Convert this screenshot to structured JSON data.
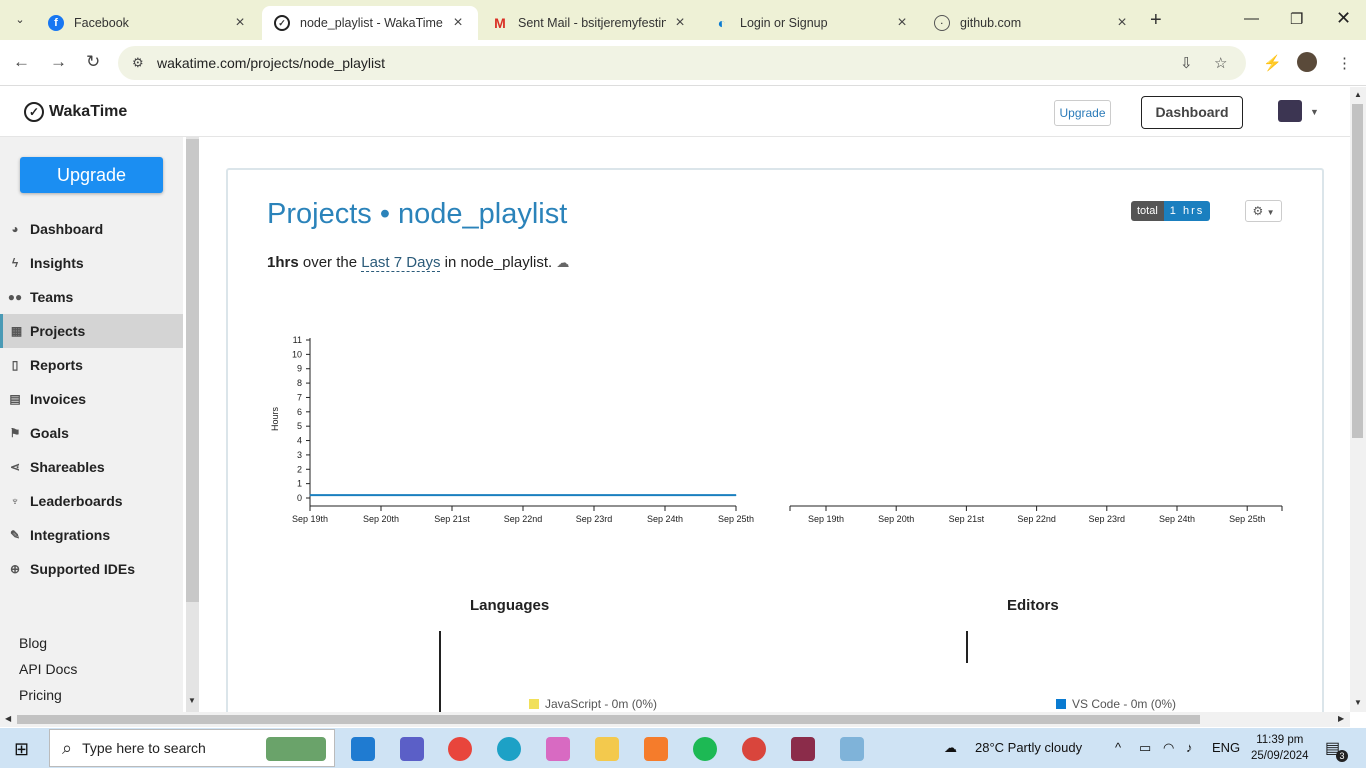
{
  "browser": {
    "tabs": [
      {
        "title": "Facebook",
        "icon": "facebook-icon"
      },
      {
        "title": "node_playlist - WakaTime",
        "icon": "wakatime-icon"
      },
      {
        "title": "Sent Mail - bsitjeremyfestin@",
        "icon": "gmail-icon"
      },
      {
        "title": "Login or Signup",
        "icon": "login-icon"
      },
      {
        "title": "github.com",
        "icon": "globe-icon"
      }
    ],
    "url": "wakatime.com/projects/node_playlist"
  },
  "header": {
    "logo": "WakaTime",
    "upgrade_label": "Upgrade",
    "dashboard_label": "Dashboard"
  },
  "sidebar": {
    "upgrade_label": "Upgrade",
    "items": [
      {
        "label": "Dashboard",
        "icon": "dashboard-icon"
      },
      {
        "label": "Insights",
        "icon": "bolt-icon"
      },
      {
        "label": "Teams",
        "icon": "users-icon"
      },
      {
        "label": "Projects",
        "icon": "grid-icon"
      },
      {
        "label": "Reports",
        "icon": "report-icon"
      },
      {
        "label": "Invoices",
        "icon": "invoice-icon"
      },
      {
        "label": "Goals",
        "icon": "flag-icon"
      },
      {
        "label": "Shareables",
        "icon": "share-icon"
      },
      {
        "label": "Leaderboards",
        "icon": "trophy-icon"
      },
      {
        "label": "Integrations",
        "icon": "wrench-icon"
      },
      {
        "label": "Supported IDEs",
        "icon": "plus-circle-icon"
      }
    ],
    "links": [
      "Blog",
      "API Docs",
      "Pricing"
    ]
  },
  "main": {
    "title": "Projects • node_playlist",
    "summary": {
      "hours": "1hrs",
      "text1": " over the ",
      "range": "Last 7 Days",
      "text2": " in node_playlist."
    },
    "badge_left": "total",
    "badge_right": "1 hrs",
    "languages_title": "Languages",
    "editors_title": "Editors",
    "languages_legend": "JavaScript - 0m (0%)",
    "editors_legend": "VS Code - 0m (0%)",
    "javascript_color": "#f1e05a",
    "vscode_color": "#0a7bd1"
  },
  "chart_data": [
    {
      "type": "line",
      "x": [
        "Sep 19th",
        "Sep 20th",
        "Sep 21st",
        "Sep 22nd",
        "Sep 23rd",
        "Sep 24th",
        "Sep 25th"
      ],
      "values": [
        0.2,
        0.2,
        0.2,
        0.2,
        0.2,
        0.2,
        0.2
      ],
      "ylabel": "Hours",
      "yticks": [
        "0",
        "1",
        "2",
        "3",
        "4",
        "5",
        "6",
        "7",
        "8",
        "9",
        "10",
        "11"
      ],
      "ylim": [
        0,
        11
      ],
      "color": "#1a7fbf"
    },
    {
      "type": "bar",
      "categories": [
        "Sep 19th",
        "Sep 20th",
        "Sep 21st",
        "Sep 22nd",
        "Sep 23rd",
        "Sep 24th",
        "Sep 25th"
      ],
      "values": []
    }
  ],
  "taskbar": {
    "search_placeholder": "Type here to search",
    "weather": "28°C  Partly cloudy",
    "lang": "ENG",
    "time": "11:39 pm",
    "date": "25/09/2024",
    "notif_count": "3"
  }
}
